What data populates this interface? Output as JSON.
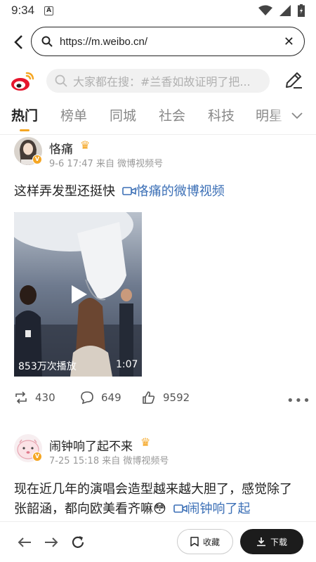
{
  "status_bar": {
    "time": "9:34",
    "notification_letter": "A"
  },
  "browser": {
    "url": "https://m.weibo.cn/",
    "clear_label": "✕"
  },
  "header": {
    "search_placeholder": "大家都在搜：#兰香如故证明了把..."
  },
  "tabs": [
    {
      "label": "热门",
      "active": true
    },
    {
      "label": "榜单"
    },
    {
      "label": "同城"
    },
    {
      "label": "社会"
    },
    {
      "label": "科技"
    },
    {
      "label": "明星"
    }
  ],
  "posts": [
    {
      "user": "恪痛",
      "meta": "9-6 17:47 来自 微博视频号",
      "text": "这样弄发型还挺快",
      "video_link": "恪痛的微博视频",
      "video": {
        "views": "853万次播放",
        "duration": "1:07"
      },
      "actions": {
        "repost": "430",
        "comment": "649",
        "like": "9592"
      }
    },
    {
      "user": "闹钟响了起不来",
      "meta": "7-25 15:18 来自 微博视频号",
      "text": "现在近几年的演唱会造型越来越大胆了，感觉除了张韶涵，都向欧美看齐嘛😳",
      "video_link": "闹钟响了起"
    }
  ],
  "bottom_bar": {
    "favorite_label": "收藏",
    "download_label": "下载"
  },
  "colors": {
    "accent_orange": "#f5a623",
    "link_blue": "#3b6fb6",
    "weibo_red": "#e6162d"
  }
}
